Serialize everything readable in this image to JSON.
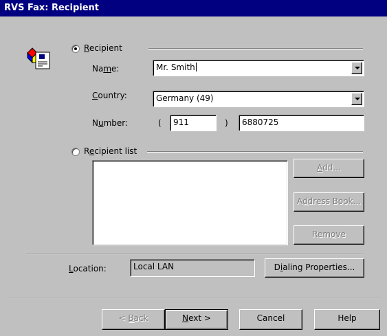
{
  "window": {
    "title": "RVS Fax: Recipient"
  },
  "recipient_group": {
    "radio_label_pre": "",
    "radio_label_u": "R",
    "radio_label_post": "ecipient",
    "selected": true,
    "name": {
      "label_pre": "Na",
      "label_u": "m",
      "label_post": "e:",
      "value": "Mr. Smith"
    },
    "country": {
      "label_pre": "",
      "label_u": "C",
      "label_post": "ountry:",
      "value": "Germany  (49)"
    },
    "number": {
      "label_pre": "N",
      "label_u": "u",
      "label_post": "mber:",
      "open_paren": "(",
      "area_code": "911",
      "close_paren": ")",
      "value": "6880725"
    }
  },
  "recipient_list_group": {
    "radio_label_pre": "R",
    "radio_label_u": "e",
    "radio_label_post": "cipient list",
    "selected": false,
    "items": [],
    "add_label_pre": "",
    "add_label_u": "A",
    "add_label_post": "dd...",
    "address_book_pre": "A",
    "address_book_u": "d",
    "address_book_post": "dress Book...",
    "remove_pre": "Rem",
    "remove_u": "o",
    "remove_post": "ve"
  },
  "location": {
    "label_pre": "",
    "label_u": "L",
    "label_post": "ocation:",
    "value": "Local LAN",
    "dialing_pre": "D",
    "dialing_u": "i",
    "dialing_post": "aling Properties..."
  },
  "footer": {
    "back_pre": "< ",
    "back_u": "B",
    "back_post": "ack",
    "next_pre": "",
    "next_u": "N",
    "next_post": "ext >",
    "cancel": "Cancel",
    "help": "Help"
  }
}
